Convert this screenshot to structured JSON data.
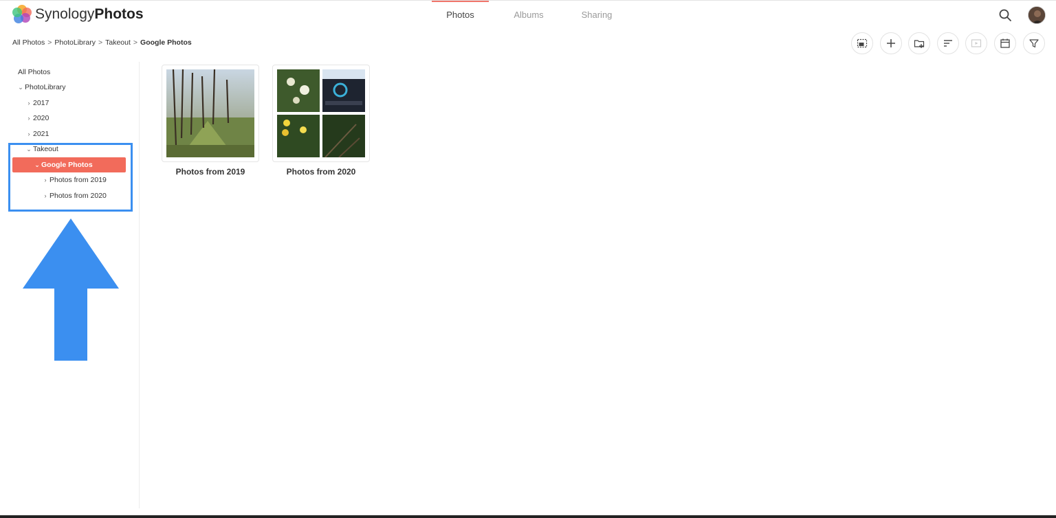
{
  "header": {
    "brand_light": "Synology",
    "brand_bold": "Photos",
    "tabs": [
      {
        "label": "Photos",
        "active": true
      },
      {
        "label": "Albums",
        "active": false
      },
      {
        "label": "Sharing",
        "active": false
      }
    ],
    "icons": {
      "search": "search-icon",
      "avatar": "user-avatar"
    }
  },
  "breadcrumb": {
    "items": [
      "All Photos",
      "PhotoLibrary",
      "Takeout"
    ],
    "current": "Google Photos",
    "separator": ">"
  },
  "toolbar": {
    "icons": [
      "select-photos-icon",
      "add-icon",
      "new-folder-icon",
      "sort-icon",
      "slideshow-icon",
      "calendar-icon",
      "filter-icon"
    ]
  },
  "sidebar": {
    "items": [
      {
        "label": "All Photos",
        "chevron": ""
      },
      {
        "label": "PhotoLibrary",
        "chevron": "⌄"
      },
      {
        "label": "2017",
        "chevron": "›"
      },
      {
        "label": "2020",
        "chevron": "›"
      },
      {
        "label": "2021",
        "chevron": "›"
      },
      {
        "label": "Takeout",
        "chevron": "⌄"
      },
      {
        "label": "Google Photos",
        "chevron": "⌄",
        "selected": true
      },
      {
        "label": "Photos from 2019",
        "chevron": "›"
      },
      {
        "label": "Photos from 2020",
        "chevron": "›"
      }
    ]
  },
  "folders": [
    {
      "label": "Photos from 2019"
    },
    {
      "label": "Photos from 2020"
    }
  ],
  "colors": {
    "accent": "#f26b5b",
    "highlight": "#3b8ff0",
    "arrow": "#3b8ff0"
  }
}
